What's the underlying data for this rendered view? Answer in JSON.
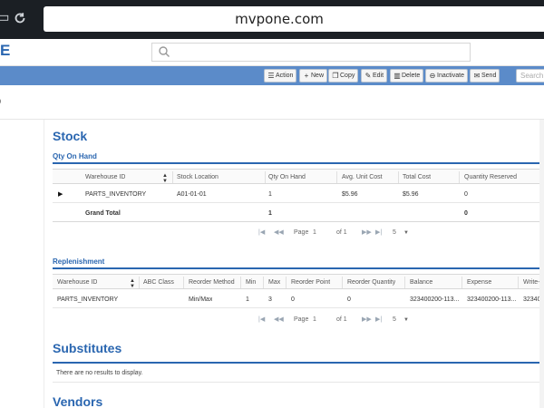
{
  "browser": {
    "url": "mvpone.com",
    "home_icon": "home-icon",
    "reload_icon": "reload-icon"
  },
  "app": {
    "logo_text": "E",
    "search_icon": "search-icon",
    "breadcrumb": "0"
  },
  "toolbar": {
    "buttons": [
      {
        "label": "Action",
        "icon": "list-icon"
      },
      {
        "label": "New",
        "icon": "plus-icon"
      },
      {
        "label": "Copy",
        "icon": "copy-icon"
      },
      {
        "label": "Edit",
        "icon": "pencil-icon"
      },
      {
        "label": "Delete",
        "icon": "trash-icon"
      },
      {
        "label": "Inactivate",
        "icon": "minus-circle-icon"
      },
      {
        "label": "Send",
        "icon": "envelope-icon"
      }
    ],
    "search_placeholder": "Search"
  },
  "stock": {
    "title": "Stock",
    "qty_on_hand": {
      "title": "Qty On Hand",
      "columns": [
        "Warehouse ID",
        "Stock Location",
        "Qty On Hand",
        "Avg. Unit Cost",
        "Total Cost",
        "Quantity Reserved"
      ],
      "rows": [
        [
          "PARTS_INVENTORY",
          "A01-01-01",
          "1",
          "$5.96",
          "$5.96",
          "0"
        ]
      ],
      "grand_total": {
        "label": "Grand Total",
        "qty": "1",
        "reserved": "0"
      },
      "pager": {
        "page_label": "Page",
        "page": "1",
        "of_label": "of 1",
        "page_size": "5"
      }
    },
    "replenishment": {
      "title": "Replenishment",
      "columns": [
        "Warehouse ID",
        "ABC Class",
        "Reorder Method",
        "Min",
        "Max",
        "Reorder Point",
        "Reorder Quantity",
        "Balance",
        "Expense",
        "Write-C"
      ],
      "rows": [
        [
          "PARTS_INVENTORY",
          "",
          "Min/Max",
          "1",
          "3",
          "0",
          "0",
          "323400200-113...",
          "323400200-113...",
          "32340"
        ]
      ],
      "pager": {
        "page_label": "Page",
        "page": "1",
        "of_label": "of 1",
        "page_size": "5"
      }
    }
  },
  "substitutes": {
    "title": "Substitutes",
    "empty_text": "There are no results to display."
  },
  "vendors": {
    "title": "Vendors"
  }
}
